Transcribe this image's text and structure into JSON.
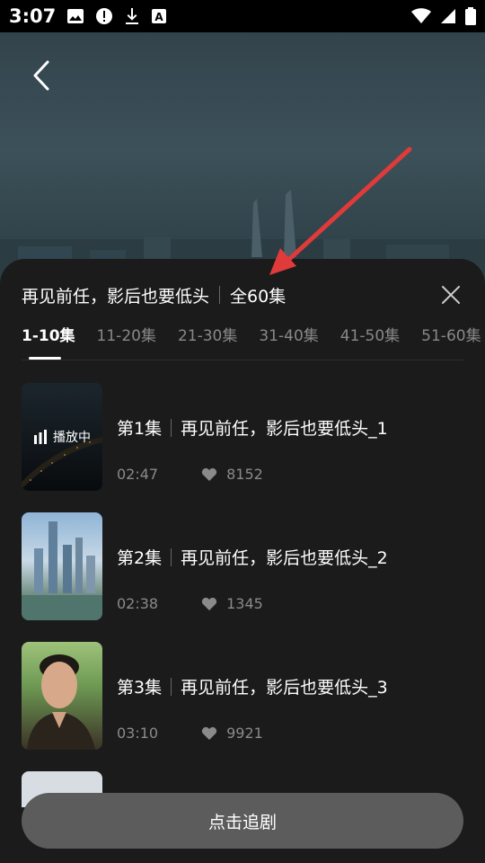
{
  "status_bar": {
    "time": "3:07",
    "left_icons": [
      "image-icon",
      "alert-icon",
      "download-icon",
      "a-box-icon"
    ],
    "right_icons": [
      "wifi-icon",
      "signal-icon",
      "battery-icon"
    ]
  },
  "header": {
    "title": "再见前任，影后也要低头",
    "total": "全60集"
  },
  "tabs": [
    {
      "label": "1-10集",
      "active": true
    },
    {
      "label": "11-20集",
      "active": false
    },
    {
      "label": "21-30集",
      "active": false
    },
    {
      "label": "31-40集",
      "active": false
    },
    {
      "label": "41-50集",
      "active": false
    },
    {
      "label": "51-60集",
      "active": false
    }
  ],
  "episodes": [
    {
      "num": "第1集",
      "name": "再见前任，影后也要低头_1",
      "duration": "02:47",
      "likes": "8152",
      "playing_label": "播放中"
    },
    {
      "num": "第2集",
      "name": "再见前任，影后也要低头_2",
      "duration": "02:38",
      "likes": "1345"
    },
    {
      "num": "第3集",
      "name": "再见前任，影后也要低头_3",
      "duration": "03:10",
      "likes": "9921"
    }
  ],
  "follow_button": "点击追剧",
  "colors": {
    "sheet_bg": "#1b1b1c",
    "button_bg": "#5c5c5c",
    "annotation_arrow": "#e03a3a"
  }
}
